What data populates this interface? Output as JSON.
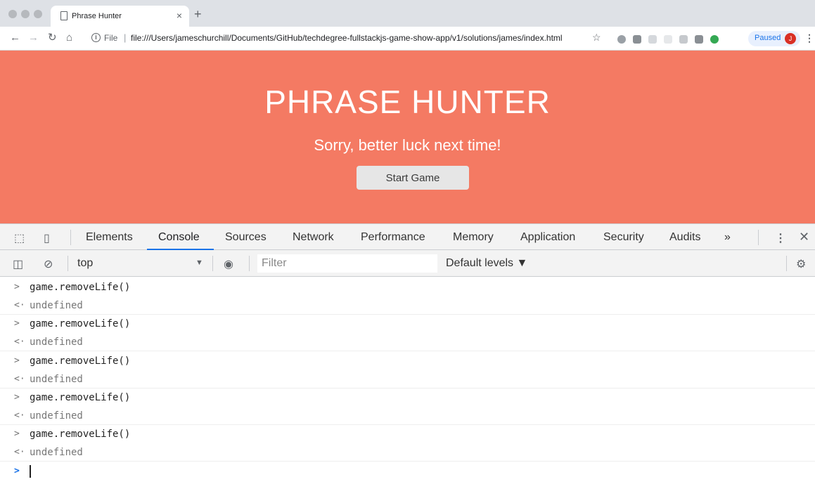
{
  "browser": {
    "tab_title": "Phrase Hunter",
    "tab_close": "×",
    "new_tab": "+",
    "file_label": "File",
    "url": "file:///Users/jameschurchill/Documents/GitHub/techdegree-fullstackjs-game-show-app/v1/solutions/james/index.html",
    "paused_label": "Paused",
    "avatar_initial": "J"
  },
  "page": {
    "title": "PHRASE HUNTER",
    "message": "Sorry, better luck next time!",
    "start_button": "Start Game",
    "background_color": "#f47a63"
  },
  "devtools": {
    "tabs": [
      "Elements",
      "Console",
      "Sources",
      "Network",
      "Performance",
      "Memory",
      "Application",
      "Security",
      "Audits"
    ],
    "active_tab": "Console",
    "more_tabs": "»",
    "context": "top",
    "filter_placeholder": "Filter",
    "levels": "Default levels ▼"
  },
  "console": {
    "entries": [
      {
        "input": "game.removeLife()",
        "output": "undefined"
      },
      {
        "input": "game.removeLife()",
        "output": "undefined"
      },
      {
        "input": "game.removeLife()",
        "output": "undefined"
      },
      {
        "input": "game.removeLife()",
        "output": "undefined"
      },
      {
        "input": "game.removeLife()",
        "output": "undefined"
      }
    ]
  }
}
